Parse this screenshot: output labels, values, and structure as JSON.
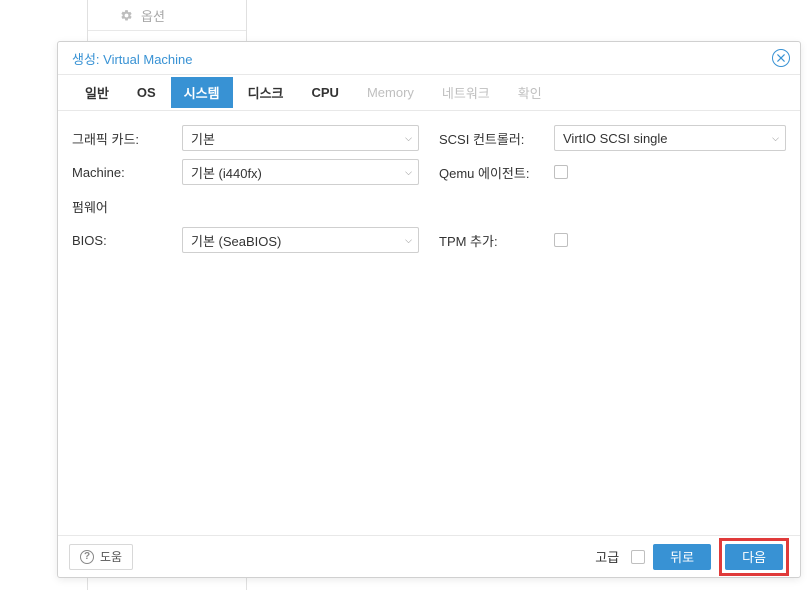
{
  "bg_sidebar": {
    "options_label": "옵션"
  },
  "dialog": {
    "title": "생성: Virtual Machine"
  },
  "tabs": [
    {
      "label": "일반",
      "state": "normal"
    },
    {
      "label": "OS",
      "state": "normal"
    },
    {
      "label": "시스템",
      "state": "active"
    },
    {
      "label": "디스크",
      "state": "normal"
    },
    {
      "label": "CPU",
      "state": "normal"
    },
    {
      "label": "Memory",
      "state": "disabled"
    },
    {
      "label": "네트워크",
      "state": "disabled"
    },
    {
      "label": "확인",
      "state": "disabled"
    }
  ],
  "left_col": {
    "graphics_label": "그래픽 카드:",
    "graphics_value": "기본",
    "machine_label": "Machine:",
    "machine_value": "기본 (i440fx)",
    "firmware_label": "펌웨어",
    "bios_label": "BIOS:",
    "bios_value": "기본 (SeaBIOS)"
  },
  "right_col": {
    "scsi_label": "SCSI 컨트롤러:",
    "scsi_value": "VirtIO SCSI single",
    "qemu_agent_label": "Qemu 에이전트:",
    "tpm_label": "TPM 추가:"
  },
  "footer": {
    "help_label": "도움",
    "advanced_label": "고급",
    "back_label": "뒤로",
    "next_label": "다음"
  }
}
